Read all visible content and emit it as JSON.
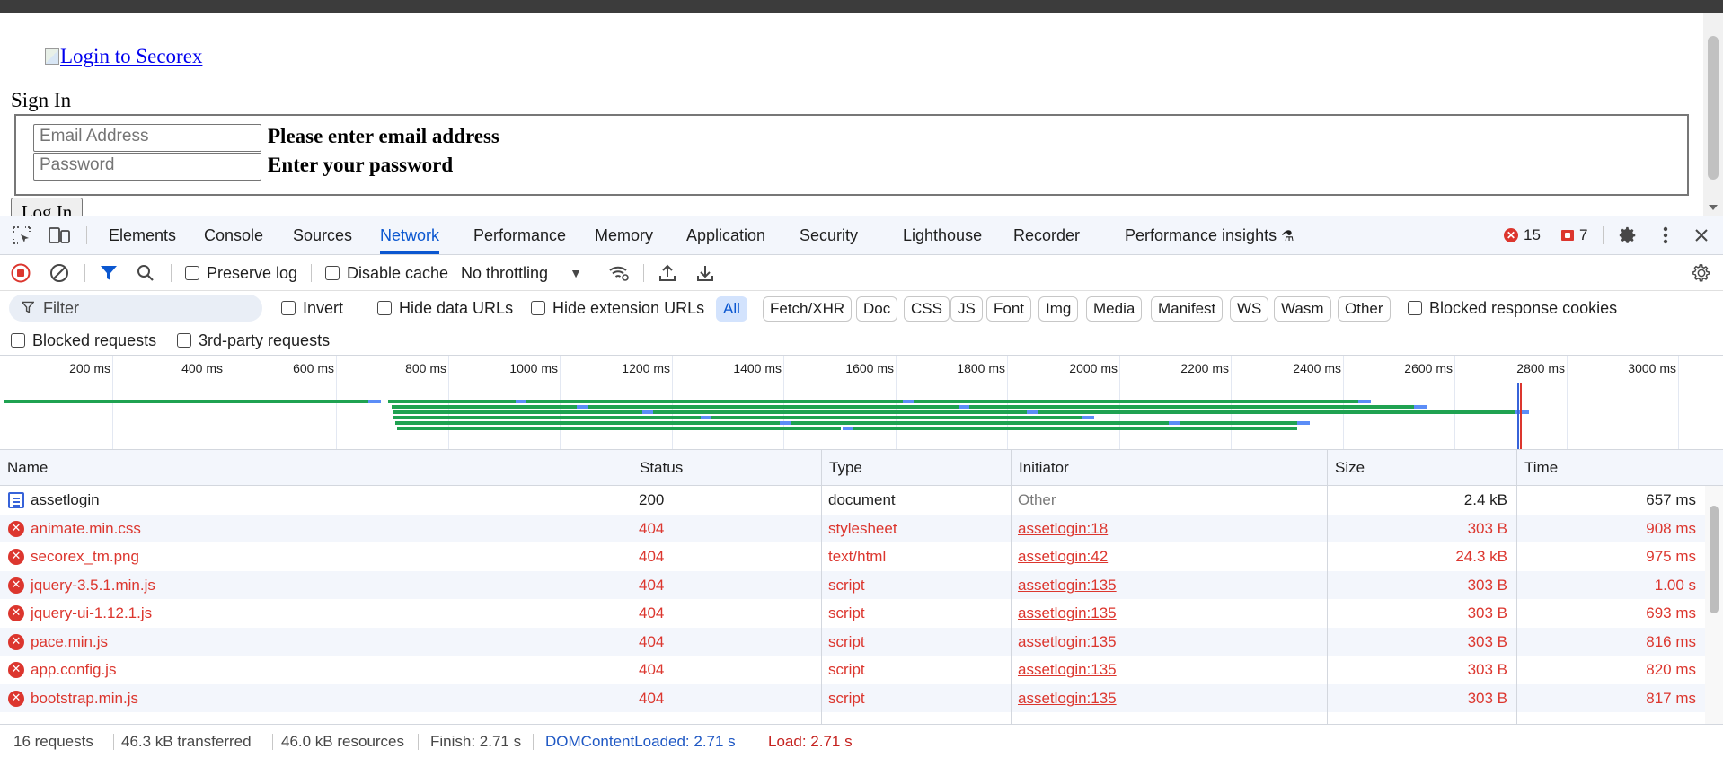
{
  "page": {
    "logo_alt": "Login to Secorex",
    "heading": "Sign In",
    "email_placeholder": "Email Address",
    "email_hint": "Please enter email address",
    "password_placeholder": "Password",
    "password_hint": "Enter your password",
    "login_label": "Log In"
  },
  "devtools": {
    "tabs": [
      "Elements",
      "Console",
      "Sources",
      "Network",
      "Performance",
      "Memory",
      "Application",
      "Security",
      "Lighthouse",
      "Recorder",
      "Performance insights"
    ],
    "active_tab": "Network",
    "errors_count": "15",
    "issues_count": "7",
    "toolbar": {
      "preserve_log": "Preserve log",
      "disable_cache": "Disable cache",
      "throttling": "No throttling"
    },
    "filter": {
      "placeholder": "Filter",
      "invert": "Invert",
      "hide_data_urls": "Hide data URLs",
      "hide_extension_urls": "Hide extension URLs",
      "types": [
        "All",
        "Fetch/XHR",
        "Doc",
        "CSS",
        "JS",
        "Font",
        "Img",
        "Media",
        "Manifest",
        "WS",
        "Wasm",
        "Other"
      ],
      "active_type": "All",
      "blocked_response_cookies": "Blocked response cookies",
      "blocked_requests": "Blocked requests",
      "third_party": "3rd-party requests"
    },
    "overview_ticks": [
      "200 ms",
      "400 ms",
      "600 ms",
      "800 ms",
      "1000 ms",
      "1200 ms",
      "1400 ms",
      "1600 ms",
      "1800 ms",
      "2000 ms",
      "2200 ms",
      "2400 ms",
      "2600 ms",
      "2800 ms",
      "3000 ms"
    ],
    "columns": [
      "Name",
      "Status",
      "Type",
      "Initiator",
      "Size",
      "Time"
    ],
    "rows": [
      {
        "name": "assetlogin",
        "status": "200",
        "type": "document",
        "initiator": "Other",
        "size": "2.4 kB",
        "time": "657 ms",
        "error": false
      },
      {
        "name": "animate.min.css",
        "status": "404",
        "type": "stylesheet",
        "initiator": "assetlogin:18",
        "size": "303 B",
        "time": "908 ms",
        "error": true
      },
      {
        "name": "secorex_tm.png",
        "status": "404",
        "type": "text/html",
        "initiator": "assetlogin:42",
        "size": "24.3 kB",
        "time": "975 ms",
        "error": true
      },
      {
        "name": "jquery-3.5.1.min.js",
        "status": "404",
        "type": "script",
        "initiator": "assetlogin:135",
        "size": "303 B",
        "time": "1.00 s",
        "error": true
      },
      {
        "name": "jquery-ui-1.12.1.js",
        "status": "404",
        "type": "script",
        "initiator": "assetlogin:135",
        "size": "303 B",
        "time": "693 ms",
        "error": true
      },
      {
        "name": "pace.min.js",
        "status": "404",
        "type": "script",
        "initiator": "assetlogin:135",
        "size": "303 B",
        "time": "816 ms",
        "error": true
      },
      {
        "name": "app.config.js",
        "status": "404",
        "type": "script",
        "initiator": "assetlogin:135",
        "size": "303 B",
        "time": "820 ms",
        "error": true
      },
      {
        "name": "bootstrap.min.js",
        "status": "404",
        "type": "script",
        "initiator": "assetlogin:135",
        "size": "303 B",
        "time": "817 ms",
        "error": true
      }
    ],
    "status": {
      "requests": "16 requests",
      "transferred": "46.3 kB transferred",
      "resources": "46.0 kB resources",
      "finish": "Finish: 2.71 s",
      "dom_content_loaded": "DOMContentLoaded: 2.71 s",
      "load": "Load: 2.71 s"
    },
    "colors": {
      "accent": "#0b57d0",
      "error": "#dc362e",
      "bar": "#1fa251"
    }
  }
}
